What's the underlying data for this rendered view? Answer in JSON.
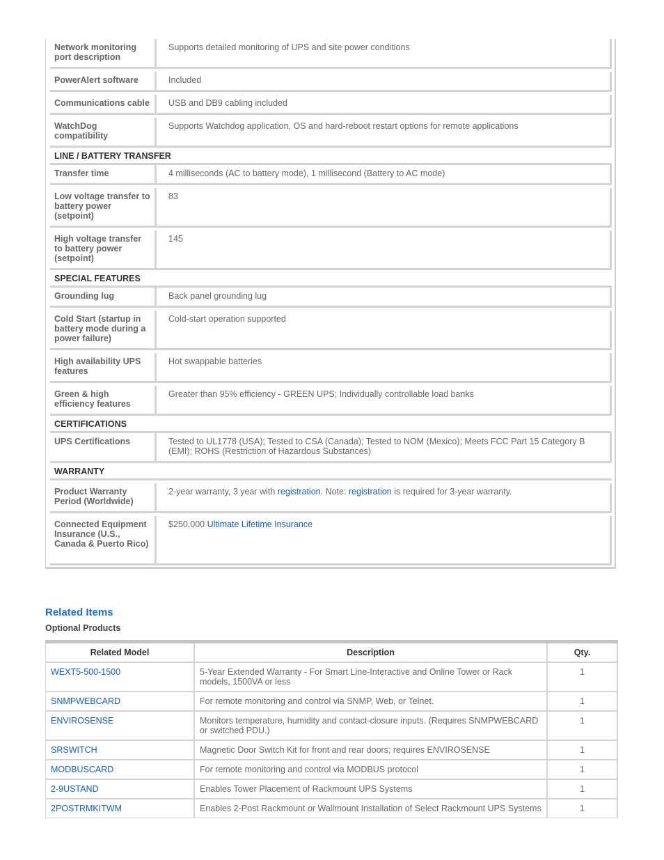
{
  "spec_table": {
    "rows": [
      {
        "type": "row",
        "label": "Network monitoring port description",
        "value": "Supports detailed monitoring of UPS and site power conditions"
      },
      {
        "type": "row",
        "label": "PowerAlert software",
        "value": "Included"
      },
      {
        "type": "row",
        "label": "Communications cable",
        "value": "USB and DB9 cabling included"
      },
      {
        "type": "row",
        "label": "WatchDog compatibility",
        "value": "Supports Watchdog application, OS and hard-reboot restart options for remote applications"
      },
      {
        "type": "section",
        "label": "LINE / BATTERY TRANSFER"
      },
      {
        "type": "row",
        "label": "Transfer time",
        "value": "4 milliseconds (AC to battery mode), 1 millisecond (Battery to AC mode)"
      },
      {
        "type": "row",
        "label": "Low voltage transfer to battery power (setpoint)",
        "value": "83"
      },
      {
        "type": "row",
        "label": "High voltage transfer to battery power (setpoint)",
        "value": "145"
      },
      {
        "type": "section",
        "label": "SPECIAL FEATURES"
      },
      {
        "type": "row",
        "label": "Grounding lug",
        "value": "Back panel grounding lug"
      },
      {
        "type": "row",
        "label": "Cold Start (startup in battery mode during a power failure)",
        "value": "Cold-start operation supported"
      },
      {
        "type": "row",
        "label": "High availability UPS features",
        "value": "Hot swappable batteries"
      },
      {
        "type": "row",
        "label": "Green & high efficiency features",
        "value": "Greater than 95% efficiency - GREEN UPS; Individually controllable load banks"
      },
      {
        "type": "section",
        "label": "CERTIFICATIONS"
      },
      {
        "type": "row",
        "label": "UPS Certifications",
        "value": "Tested to UL1778 (USA); Tested to CSA (Canada); Tested to NOM (Mexico); Meets FCC Part 15 Category B (EMI); ROHS (Restriction of Hazardous Substances)"
      },
      {
        "type": "section",
        "label": "WARRANTY"
      }
    ],
    "warranty_period": {
      "label": "Product Warranty Period (Worldwide)",
      "text_1": "2-year warranty, 3 year with ",
      "link_1": "registration",
      "text_2": ". Note: ",
      "link_2": "registration",
      "text_3": " is required for 3-year warranty."
    },
    "insurance": {
      "label": "Connected Equipment Insurance (U.S., Canada & Puerto Rico)",
      "amount": "$250,000 ",
      "link": "Ultimate Lifetime Insurance"
    }
  },
  "related": {
    "title": "Related Items",
    "subtitle": "Optional Products",
    "headers": {
      "model": "Related Model",
      "description": "Description",
      "qty": "Qty."
    },
    "items": [
      {
        "model": "WEXT5-500-1500",
        "description": "5-Year Extended Warranty - For Smart Line-Interactive and Online Tower or Rack models, 1500VA or less",
        "qty": "1"
      },
      {
        "model": "SNMPWEBCARD",
        "description": "For remote monitoring and control via SNMP, Web, or Telnet.",
        "qty": "1"
      },
      {
        "model": "ENVIROSENSE",
        "description": "Monitors temperature, humidity and contact-closure inputs. (Requires SNMPWEBCARD or switched PDU.)",
        "qty": "1"
      },
      {
        "model": "SRSWITCH",
        "description": "Magnetic Door Switch Kit for front and rear doors; requires ENVIROSENSE",
        "qty": "1"
      },
      {
        "model": "MODBUSCARD",
        "description": "For remote monitoring and control via MODBUS protocol",
        "qty": "1"
      },
      {
        "model": "2-9USTAND",
        "description": "Enables Tower Placement of Rackmount UPS Systems",
        "qty": "1"
      },
      {
        "model": "2POSTRMKITWM",
        "description": "Enables 2-Post Rackmount or Wallmount Installation of Select Rackmount UPS Systems",
        "qty": "1"
      }
    ]
  },
  "colors": {
    "link": "#1a5fb4",
    "heading": "#1a6fd0",
    "border": "#d4d4d4"
  }
}
